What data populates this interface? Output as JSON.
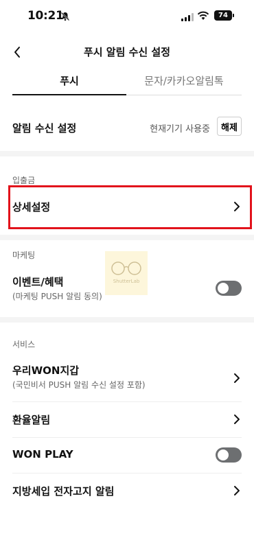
{
  "status_bar": {
    "time": "10:21",
    "battery": "74"
  },
  "nav": {
    "title": "푸시 알림 수신 설정"
  },
  "tabs": [
    {
      "label": "푸시",
      "active": true
    },
    {
      "label": "문자/카카오알림톡",
      "active": false
    }
  ],
  "notification_setting": {
    "label": "알림 수신 설정",
    "current_device": "현재기기 사용중",
    "button_label": "해제"
  },
  "sections": {
    "deposit": {
      "title": "입출금",
      "detail_label": "상세설정"
    },
    "marketing": {
      "title": "마케팅",
      "event_label": "이벤트/혜택",
      "event_sub": "(마케팅 PUSH 알림 동의)",
      "event_toggle_on": false
    },
    "service": {
      "title": "서비스",
      "wallet_label": "우리WON지갑",
      "wallet_sub": "(국민비서 PUSH 알림 수신 설정 포함)",
      "fx_label": "환율알림",
      "wonplay_label": "WON PLAY",
      "wonplay_toggle_on": false,
      "tax_label": "지방세입 전자고지 알림"
    }
  },
  "watermark": {
    "text": "ShutterLab"
  },
  "colors": {
    "highlight": "#e2121b",
    "toggle_off": "#6d6f71"
  }
}
